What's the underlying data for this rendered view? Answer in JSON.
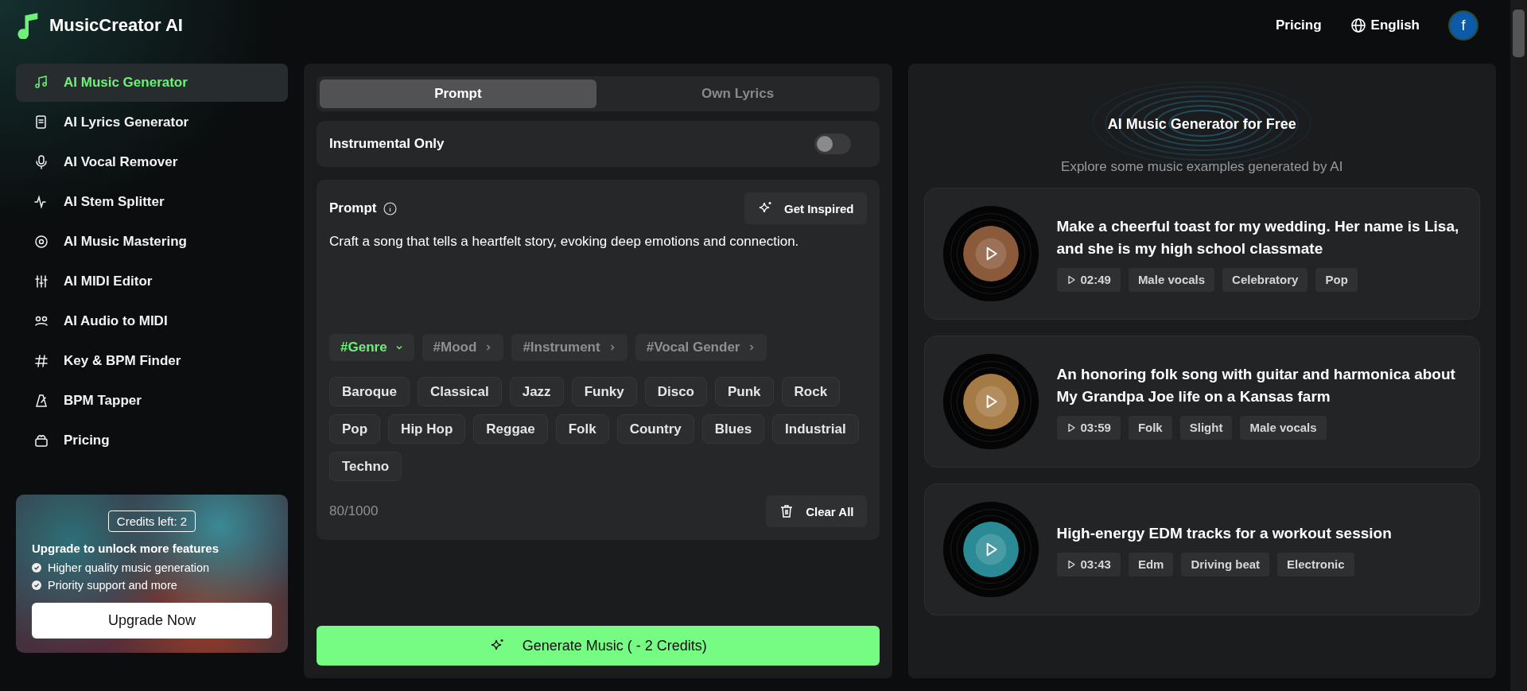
{
  "brand": {
    "name": "MusicCreator AI"
  },
  "header": {
    "pricing": "Pricing",
    "language": "English",
    "avatar": "f"
  },
  "sidebar": {
    "items": [
      {
        "label": "AI Music Generator",
        "selected": true
      },
      {
        "label": "AI Lyrics Generator",
        "selected": false
      },
      {
        "label": "AI Vocal Remover",
        "selected": false
      },
      {
        "label": "AI Stem Splitter",
        "selected": false
      },
      {
        "label": "AI Music Mastering",
        "selected": false
      },
      {
        "label": "AI MIDI Editor",
        "selected": false
      },
      {
        "label": "AI Audio to MIDI",
        "selected": false
      },
      {
        "label": "Key & BPM Finder",
        "selected": false
      },
      {
        "label": "BPM Tapper",
        "selected": false
      },
      {
        "label": "Pricing",
        "selected": false
      }
    ]
  },
  "promo": {
    "credits": "Credits left: 2",
    "title": "Upgrade to unlock more features",
    "features": [
      "Higher quality music generation",
      "Priority support and more"
    ],
    "button": "Upgrade Now"
  },
  "tabs": [
    {
      "label": "Prompt",
      "selected": true
    },
    {
      "label": "Own Lyrics",
      "selected": false
    }
  ],
  "instrumental": {
    "label": "Instrumental Only",
    "on": false
  },
  "prompt": {
    "label": "Prompt",
    "inspire_button": "Get Inspired",
    "value": "Craft a song that tells a heartfelt story, evoking deep emotions and connection.",
    "categories": [
      {
        "label": "#Genre",
        "expanded": true
      },
      {
        "label": "#Mood",
        "expanded": false
      },
      {
        "label": "#Instrument",
        "expanded": false
      },
      {
        "label": "#Vocal Gender",
        "expanded": false
      }
    ],
    "tags": [
      "Baroque",
      "Classical",
      "Jazz",
      "Funky",
      "Disco",
      "Punk",
      "Rock",
      "Pop",
      "Hip Hop",
      "Reggae",
      "Folk",
      "Country",
      "Blues",
      "Industrial",
      "Techno"
    ],
    "counter": "80/1000",
    "clear_button": "Clear All"
  },
  "generate_button": "Generate Music ( - 2 Credits)",
  "examples": {
    "title": "AI Music Generator for Free",
    "subtitle": "Explore some music examples generated by AI",
    "items": [
      {
        "title": "Make a cheerful toast for my wedding. Her name is Lisa, and she is my high school classmate",
        "duration": "02:49",
        "tags": [
          "Male vocals",
          "Celebratory",
          "Pop"
        ]
      },
      {
        "title": "An honoring folk song with guitar and harmonica about My Grandpa Joe life on a Kansas farm",
        "duration": "03:59",
        "tags": [
          "Folk",
          "Slight",
          "Male vocals"
        ]
      },
      {
        "title": "High-energy EDM tracks for a workout session",
        "duration": "03:43",
        "tags": [
          "Edm",
          "Driving beat",
          "Electronic"
        ]
      }
    ]
  }
}
